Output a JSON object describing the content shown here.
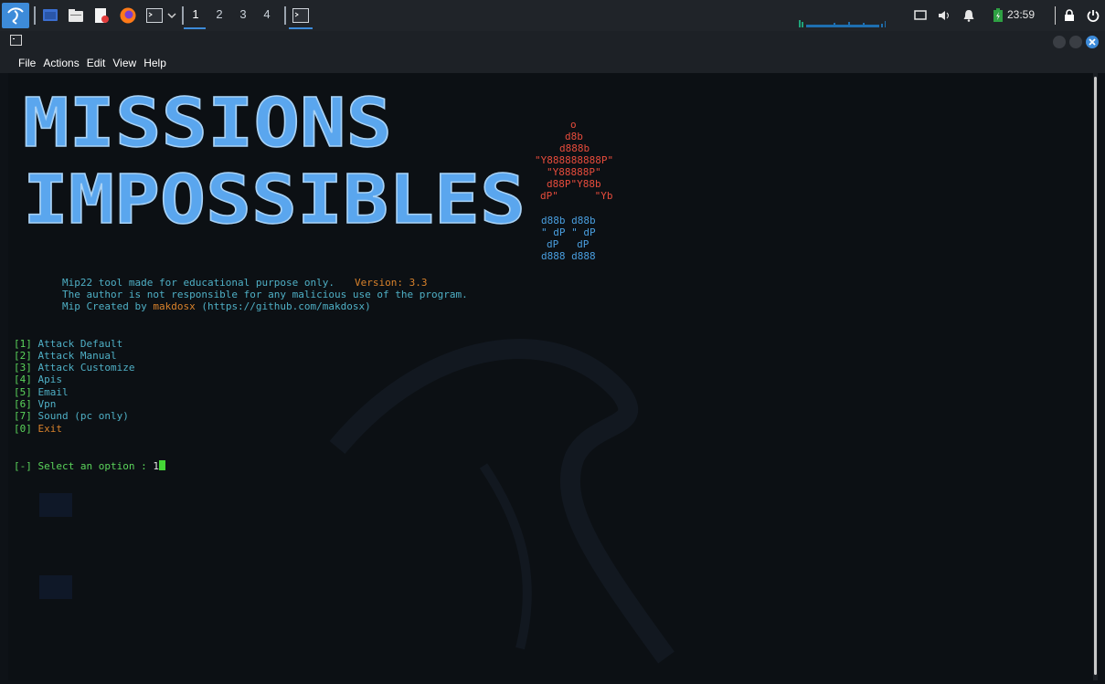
{
  "taskbar": {
    "workspaces": [
      "1",
      "2",
      "3",
      "4"
    ],
    "active_workspace": "1",
    "clock": "23:59",
    "icons": [
      "kali-menu-icon",
      "show-desktop-icon",
      "file-manager-icon",
      "text-editor-icon",
      "firefox-icon",
      "terminal-icon",
      "dropdown-icon",
      "terminal-window-icon",
      "network-graph-icon",
      "display-icon",
      "volume-icon",
      "notification-icon",
      "battery-icon",
      "lock-icon",
      "power-icon"
    ]
  },
  "window": {
    "menu": [
      "File",
      "Actions",
      "Edit",
      "View",
      "Help"
    ]
  },
  "terminal": {
    "title_line1": "MISSIONS",
    "title_line2": "IMPOSSIBLES",
    "art_red": [
      "o",
      "d8b",
      "d888b",
      "\"Y888888888P\"",
      "\"Y88888P\"",
      "d88P\"Y88b",
      "dP\"      \"Yb"
    ],
    "art_blue": [
      "d88b d88b",
      "\" dP \" dP",
      "dP   dP",
      "d888 d888"
    ],
    "info_line1_a": "Mip22 tool made for educational purpose only.",
    "info_line1_b": "Version: 3.3",
    "info_line2": "The author is not responsible for any malicious use of the program.",
    "info_line3_a": "Mip Created by ",
    "info_line3_b": "makdosx",
    "info_line3_c": " (https://github.com/makdosx)",
    "options": [
      {
        "key": "[1]",
        "label": "Attack Default"
      },
      {
        "key": "[2]",
        "label": "Attack Manual"
      },
      {
        "key": "[3]",
        "label": "Attack Customize"
      },
      {
        "key": "[4]",
        "label": "Apis"
      },
      {
        "key": "[5]",
        "label": "Email"
      },
      {
        "key": "[6]",
        "label": "Vpn"
      },
      {
        "key": "[7]",
        "label": "Sound (pc only)"
      },
      {
        "key": "[0]",
        "label": "Exit"
      }
    ],
    "prompt": "[-] Select an option : ",
    "input_value": "1"
  },
  "colors": {
    "accent": "#3d8bd9",
    "red": "#e74c3c",
    "blue": "#4a9fe0",
    "cyan": "#4fb0c6",
    "orange": "#d9822b",
    "green": "#5bd45b"
  }
}
